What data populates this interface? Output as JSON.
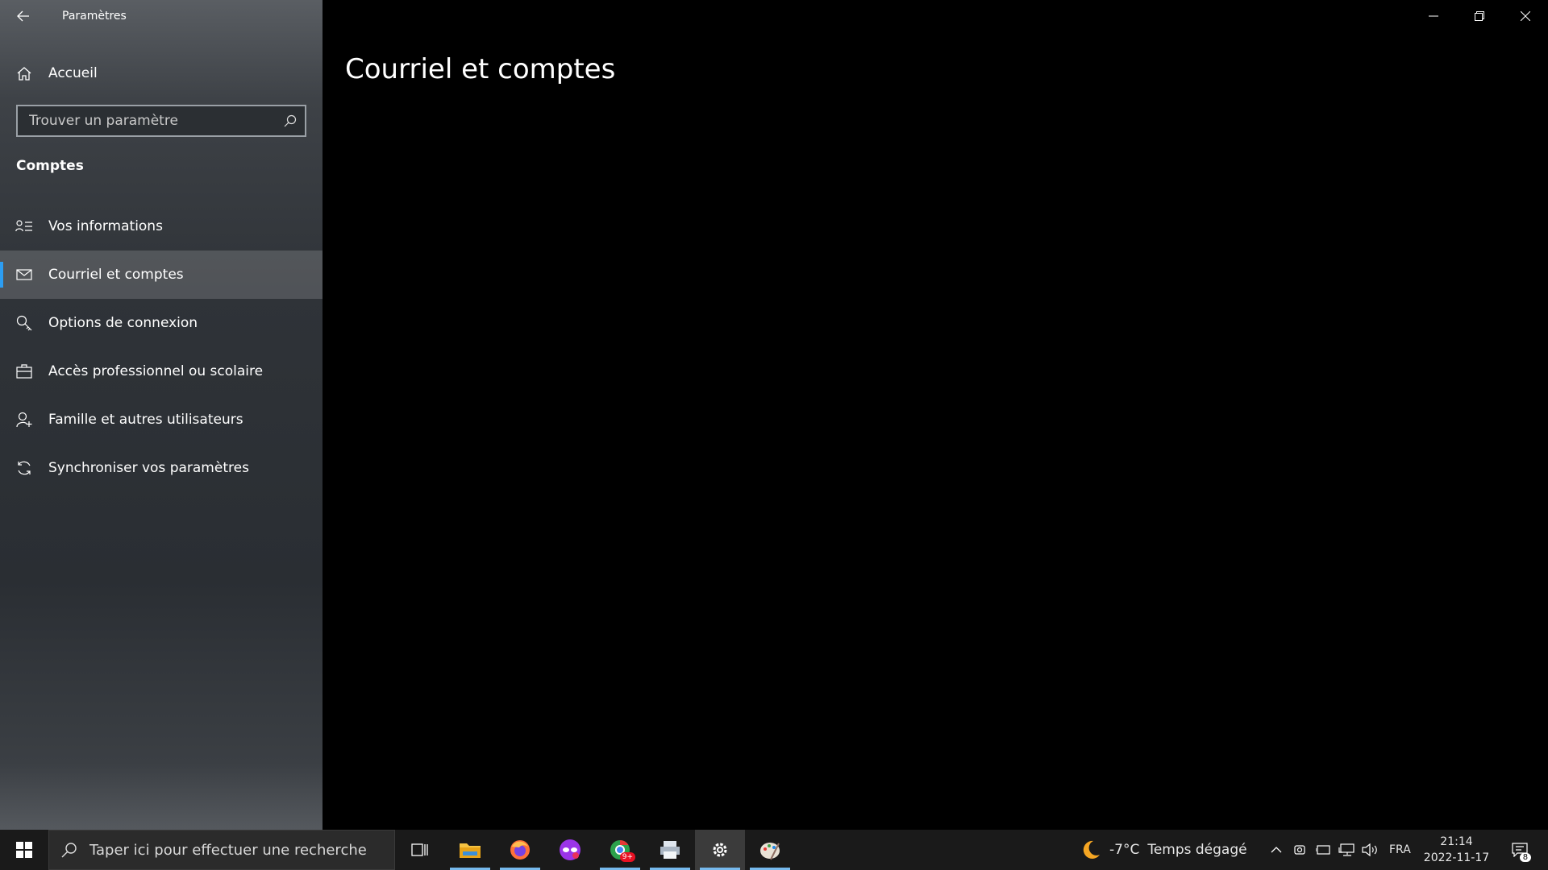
{
  "window": {
    "app_title": "Paramètres",
    "page_title": "Courriel et comptes"
  },
  "sidebar": {
    "home_label": "Accueil",
    "search_placeholder": "Trouver un paramètre",
    "section_title": "Comptes",
    "items": [
      {
        "label": "Vos informations",
        "icon": "person-list-icon"
      },
      {
        "label": "Courriel et comptes",
        "icon": "mail-icon",
        "active": true
      },
      {
        "label": "Options de connexion",
        "icon": "key-icon"
      },
      {
        "label": "Accès professionnel ou scolaire",
        "icon": "briefcase-icon"
      },
      {
        "label": "Famille et autres utilisateurs",
        "icon": "person-add-icon"
      },
      {
        "label": "Synchroniser vos paramètres",
        "icon": "sync-icon"
      }
    ]
  },
  "taskbar": {
    "search_placeholder": "Taper ici pour effectuer une recherche",
    "apps": [
      "file-explorer",
      "firefox",
      "mask-app",
      "chrome",
      "printer-app",
      "settings",
      "paint-app"
    ],
    "chrome_badge": "9+",
    "weather": {
      "temp": "-7°C",
      "condition": "Temps dégagé"
    },
    "language": "FRA",
    "time": "21:14",
    "date": "2022-11-17",
    "notification_count": "8"
  },
  "colors": {
    "accent": "#2c9df2",
    "taskbar_running": "#76b9ed"
  }
}
